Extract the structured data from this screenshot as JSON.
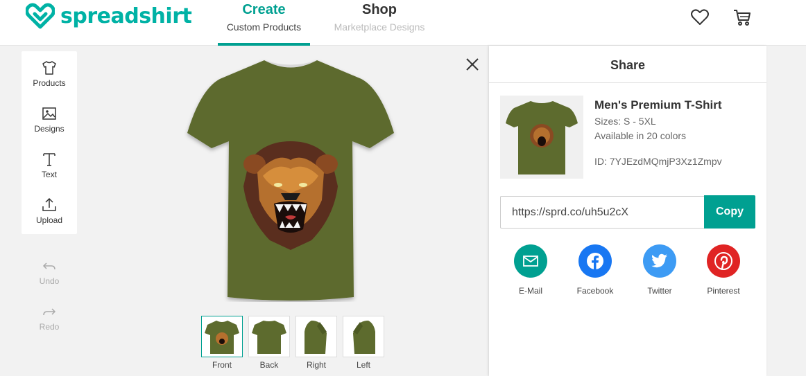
{
  "brand": {
    "name": "spreadshirt",
    "color": "#00b2a5"
  },
  "nav": [
    {
      "title": "Create",
      "subtitle": "Custom Products"
    },
    {
      "title": "Shop",
      "subtitle": "Marketplace Designs"
    }
  ],
  "header_icons": [
    "heart-icon",
    "cart-icon"
  ],
  "toolbar": [
    {
      "label": "Products",
      "icon": "tshirt-icon"
    },
    {
      "label": "Designs",
      "icon": "image-icon"
    },
    {
      "label": "Text",
      "icon": "text-icon"
    },
    {
      "label": "Upload",
      "icon": "upload-icon"
    }
  ],
  "history": [
    {
      "label": "Undo",
      "icon": "undo-icon"
    },
    {
      "label": "Redo",
      "icon": "redo-icon"
    }
  ],
  "product_color": "#5d6b2e",
  "views": [
    {
      "label": "Front",
      "selected": true
    },
    {
      "label": "Back",
      "selected": false
    },
    {
      "label": "Right",
      "selected": false
    },
    {
      "label": "Left",
      "selected": false
    }
  ],
  "share": {
    "title": "Share",
    "product_name": "Men's Premium T-Shirt",
    "sizes": "Sizes: S - 5XL",
    "colors": "Available in 20 colors",
    "id": "ID: 7YJEzdMQmjP3Xz1Zmpv",
    "url": "https://sprd.co/uh5u2cX",
    "copy_label": "Copy",
    "social": [
      {
        "label": "E-Mail",
        "color": "#00a091",
        "icon": "mail-icon"
      },
      {
        "label": "Facebook",
        "color": "#1877f2",
        "icon": "facebook-icon"
      },
      {
        "label": "Twitter",
        "color": "#3d9bf4",
        "icon": "twitter-icon"
      },
      {
        "label": "Pinterest",
        "color": "#e02424",
        "icon": "pinterest-icon"
      }
    ]
  }
}
